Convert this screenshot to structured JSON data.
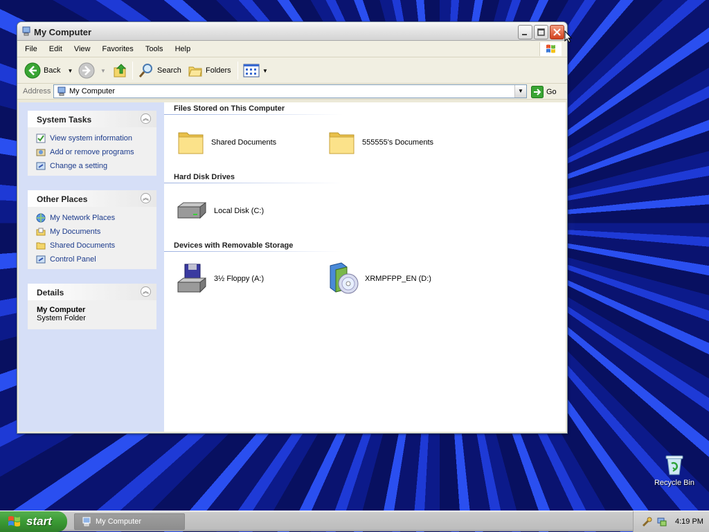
{
  "window": {
    "title": "My Computer",
    "menu": [
      "File",
      "Edit",
      "View",
      "Favorites",
      "Tools",
      "Help"
    ]
  },
  "toolbar": {
    "back_label": "Back",
    "search_label": "Search",
    "folders_label": "Folders"
  },
  "address": {
    "label": "Address",
    "value": "My Computer",
    "go_label": "Go"
  },
  "system_tasks": {
    "title": "System Tasks",
    "items": [
      "View system information",
      "Add or remove programs",
      "Change a setting"
    ]
  },
  "other_places": {
    "title": "Other Places",
    "items": [
      "My Network Places",
      "My Documents",
      "Shared Documents",
      "Control Panel"
    ]
  },
  "details": {
    "title": "Details",
    "name": "My Computer",
    "type": "System Folder"
  },
  "groups": {
    "files": {
      "title": "Files Stored on This Computer",
      "items": [
        "Shared Documents",
        "555555's Documents"
      ]
    },
    "drives": {
      "title": "Hard Disk Drives",
      "items": [
        "Local Disk (C:)"
      ]
    },
    "removable": {
      "title": "Devices with Removable Storage",
      "items": [
        "3½ Floppy (A:)",
        "XRMPFPP_EN (D:)"
      ]
    }
  },
  "desktop": {
    "recycle_bin_label": "Recycle Bin"
  },
  "taskbar": {
    "start_label": "start",
    "task_label": "My Computer",
    "clock": "4:19 PM"
  },
  "colors": {
    "link": "#1c3b8c",
    "left_pane": "#d6dff7",
    "start_green": "#3a9a34"
  }
}
